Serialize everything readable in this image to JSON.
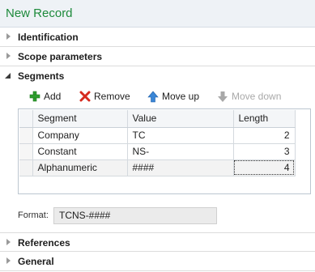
{
  "title": "New Record",
  "fasttabs": {
    "identification": "Identification",
    "scope_parameters": "Scope parameters",
    "segments": "Segments",
    "references": "References",
    "general": "General"
  },
  "toolbar": {
    "add": "Add",
    "remove": "Remove",
    "move_up": "Move up",
    "move_down": "Move down"
  },
  "grid": {
    "columns": [
      "Segment",
      "Value",
      "Length"
    ],
    "rows": [
      {
        "segment": "Company",
        "value": "TC",
        "length": "2"
      },
      {
        "segment": "Constant",
        "value": "NS-",
        "length": "3"
      },
      {
        "segment": "Alphanumeric",
        "value": "####",
        "length": "4"
      }
    ]
  },
  "format": {
    "label": "Format:",
    "value": "TCNS-####"
  },
  "colors": {
    "title": "#1d8a3b",
    "add_icon": "#2e9e2e",
    "remove_icon": "#d62a1e",
    "move_up_icon": "#3a86d6",
    "move_down_icon": "#9a9a9a"
  }
}
